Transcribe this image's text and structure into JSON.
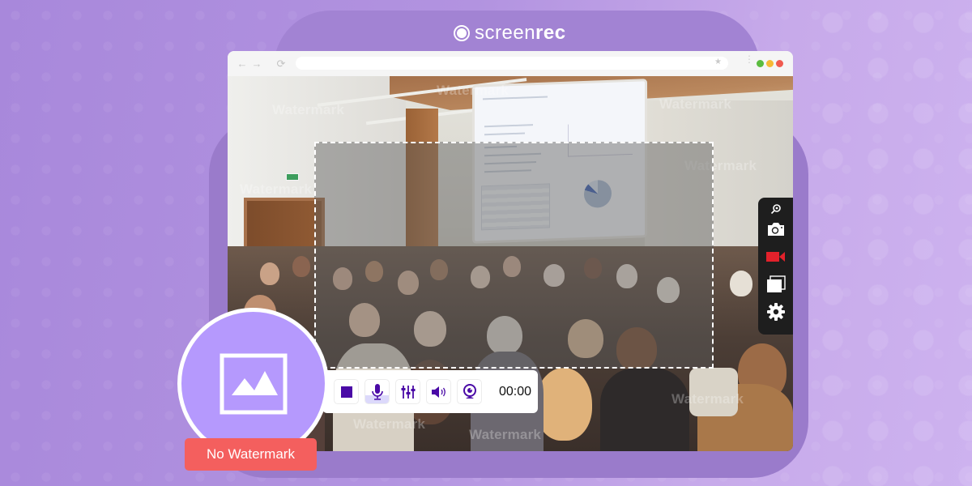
{
  "brand": {
    "name_light": "screen",
    "name_bold": "rec",
    "logo_icon": "record-ring-icon"
  },
  "browser": {
    "nav": {
      "back_icon": "arrow-left-icon",
      "forward_icon": "arrow-right-icon",
      "reload_icon": "reload-icon",
      "back_glyph": "←",
      "forward_glyph": "→",
      "reload_glyph": "⟳"
    },
    "address_bar": {
      "value": "",
      "bookmark_glyph": "★"
    },
    "menu_glyph": "⋮",
    "traffic_lights": [
      {
        "name": "green",
        "color": "#5bbc3f"
      },
      {
        "name": "yellow",
        "color": "#f6b935"
      },
      {
        "name": "red",
        "color": "#f05a4f"
      }
    ]
  },
  "watermarks": [
    "Watermark",
    "Watermark",
    "Watermark",
    "Watermark",
    "Watermark",
    "Watermark",
    "Watermark",
    "Watermark"
  ],
  "side_toolbar": {
    "items": [
      {
        "name": "pin",
        "icon": "pin-icon"
      },
      {
        "name": "screenshot",
        "icon": "camera-icon"
      },
      {
        "name": "record-video",
        "icon": "video-camera-icon",
        "color": "#e3212b",
        "active": true
      },
      {
        "name": "gallery",
        "icon": "stacked-windows-icon"
      },
      {
        "name": "settings",
        "icon": "gear-icon"
      }
    ]
  },
  "recording_bar": {
    "buttons": [
      {
        "name": "stop",
        "icon": "stop-icon"
      },
      {
        "name": "microphone",
        "icon": "microphone-icon",
        "active": true
      },
      {
        "name": "audio-mixer",
        "icon": "sliders-icon"
      },
      {
        "name": "system-sound",
        "icon": "speaker-icon"
      },
      {
        "name": "webcam",
        "icon": "webcam-icon"
      }
    ],
    "accent_color": "#4a0aa6",
    "timer": "00:00"
  },
  "badge": {
    "icon": "image-icon",
    "label": "No Watermark",
    "color": "#f45f5e"
  }
}
